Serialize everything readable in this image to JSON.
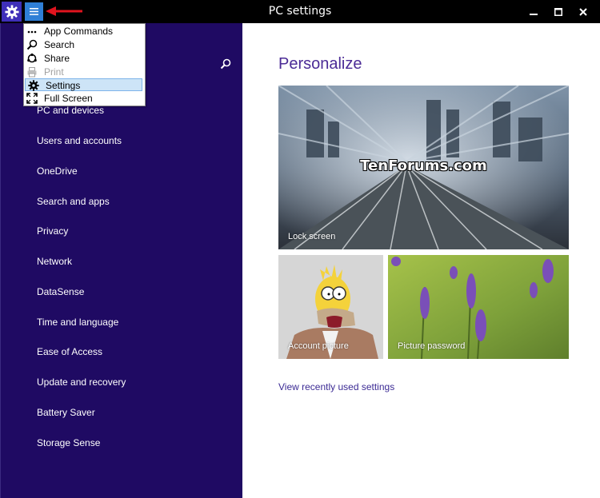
{
  "window": {
    "title": "PC settings",
    "controls": [
      "minimize-icon",
      "maximize-icon",
      "close-icon"
    ]
  },
  "app_menu": {
    "items": [
      {
        "label": "App Commands",
        "icon": "ellipsis-icon",
        "enabled": true
      },
      {
        "label": "Search",
        "icon": "search-icon",
        "enabled": true
      },
      {
        "label": "Share",
        "icon": "share-icon",
        "enabled": true
      },
      {
        "label": "Print",
        "icon": "print-icon",
        "enabled": false
      },
      {
        "label": "Settings",
        "icon": "gear-icon",
        "enabled": true,
        "selected": true
      },
      {
        "label": "Full Screen",
        "icon": "fullscreen-icon",
        "enabled": true
      }
    ]
  },
  "sidebar": {
    "items": [
      {
        "label": "PC and devices"
      },
      {
        "label": "Users and accounts"
      },
      {
        "label": "OneDrive"
      },
      {
        "label": "Search and apps"
      },
      {
        "label": "Privacy"
      },
      {
        "label": "Network"
      },
      {
        "label": "DataSense"
      },
      {
        "label": "Time and language"
      },
      {
        "label": "Ease of Access"
      },
      {
        "label": "Update and recovery"
      },
      {
        "label": "Battery Saver"
      },
      {
        "label": "Storage Sense"
      }
    ]
  },
  "main": {
    "heading": "Personalize",
    "tiles": {
      "lock_screen": "Lock screen",
      "account_picture": "Account picture",
      "picture_password": "Picture password",
      "watermark": "TenForums.com"
    },
    "recent_link": "View recently used settings"
  },
  "colors": {
    "sidebar_bg": "#1f0a63",
    "accent": "#4b2b96",
    "titlebar_bg": "#000000",
    "menu_selected": "#cde4f7"
  }
}
